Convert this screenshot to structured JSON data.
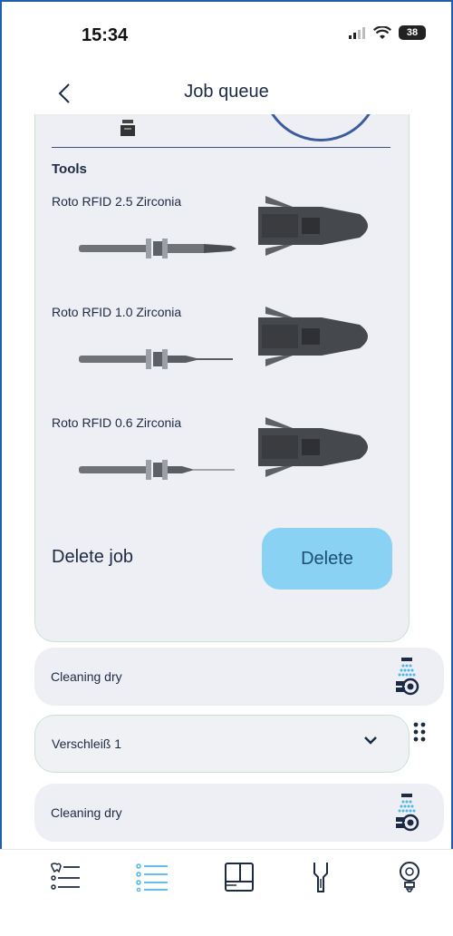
{
  "status": {
    "time": "15:34",
    "battery": "38"
  },
  "header": {
    "title": "Job queue"
  },
  "card": {
    "tools_heading": "Tools",
    "tools": [
      {
        "name": "Roto RFID 2.5 Zirconia"
      },
      {
        "name": "Roto RFID 1.0 Zirconia"
      },
      {
        "name": "Roto RFID 0.6 Zirconia"
      }
    ],
    "delete_job_label": "Delete job",
    "delete_button": "Delete"
  },
  "queue": [
    {
      "label": "Cleaning dry",
      "icon": "cleaning-spray-icon"
    },
    {
      "label": "Verschleiß 1",
      "icon": "chevron-down-icon"
    },
    {
      "label": "Cleaning dry",
      "icon": "cleaning-spray-icon"
    }
  ],
  "tabs": [
    {
      "icon": "tooth-list-icon"
    },
    {
      "icon": "list-icon"
    },
    {
      "icon": "layout-icon"
    },
    {
      "icon": "tool-icon"
    },
    {
      "icon": "bulb-icon"
    }
  ],
  "colors": {
    "accent": "#8ad2f3",
    "active_tab": "#4fb6e8",
    "card_bg": "#eeeff4",
    "text": "#1d2a44"
  }
}
